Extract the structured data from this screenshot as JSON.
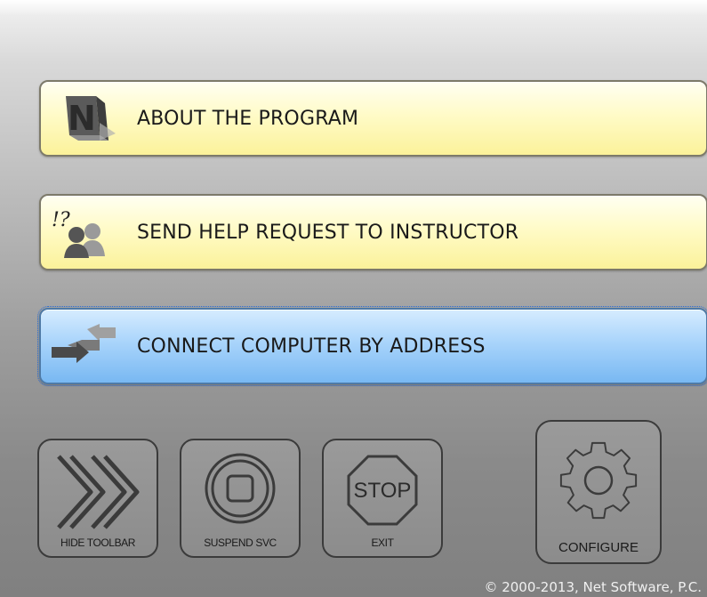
{
  "menu": {
    "items": [
      {
        "label": "ABOUT THE PROGRAM",
        "icon": "program-logo-icon",
        "style": "yellow"
      },
      {
        "label": "SEND HELP REQUEST TO INSTRUCTOR",
        "icon": "help-request-icon",
        "style": "yellow"
      },
      {
        "label": "CONNECT COMPUTER BY ADDRESS",
        "icon": "connect-arrows-icon",
        "style": "blue",
        "focused": true
      }
    ],
    "help_icon_glyph": "!?"
  },
  "toolbar": {
    "hide_label": "HIDE TOOLBAR",
    "suspend_label": "SUSPEND SVC",
    "exit_label": "EXIT",
    "stop_sign_text": "STOP",
    "configure_label": "CONFIGURE"
  },
  "footer": {
    "copyright": "© 2000-2013, Net Software, P.C."
  },
  "colors": {
    "yellow_button": "#fbf29a",
    "blue_button": "#78b8f2",
    "tool_border": "#3b3b3b"
  }
}
